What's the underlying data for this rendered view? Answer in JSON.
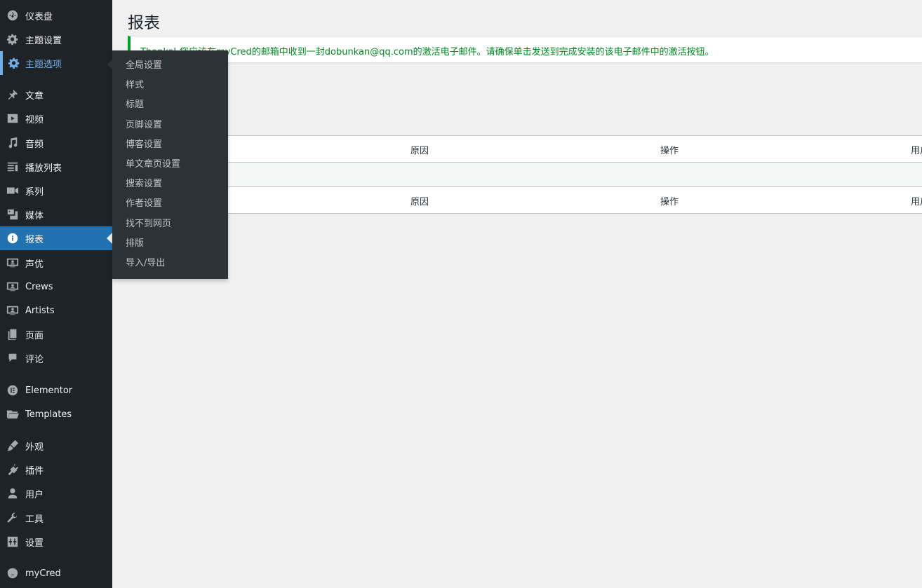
{
  "sidebar": {
    "items": [
      {
        "label": "仪表盘",
        "icon": "dashboard-icon"
      },
      {
        "label": "主题设置",
        "icon": "gear-icon"
      },
      {
        "label": "主题选项",
        "icon": "gear-icon"
      },
      {
        "label": "文章",
        "icon": "pin-icon"
      },
      {
        "label": "视频",
        "icon": "video-icon"
      },
      {
        "label": "音频",
        "icon": "music-icon"
      },
      {
        "label": "播放列表",
        "icon": "playlist-icon"
      },
      {
        "label": "系列",
        "icon": "camera-icon"
      },
      {
        "label": "媒体",
        "icon": "media-icon"
      },
      {
        "label": "报表",
        "icon": "info-icon"
      },
      {
        "label": "声优",
        "icon": "person-display-icon"
      },
      {
        "label": "Crews",
        "icon": "person-display-icon"
      },
      {
        "label": "Artists",
        "icon": "person-display-icon"
      },
      {
        "label": "页面",
        "icon": "page-icon"
      },
      {
        "label": "评论",
        "icon": "comment-icon"
      },
      {
        "label": "Elementor",
        "icon": "elementor-icon"
      },
      {
        "label": "Templates",
        "icon": "folder-icon"
      },
      {
        "label": "外观",
        "icon": "brush-icon"
      },
      {
        "label": "插件",
        "icon": "plugin-icon"
      },
      {
        "label": "用户",
        "icon": "user-icon"
      },
      {
        "label": "工具",
        "icon": "wrench-icon"
      },
      {
        "label": "设置",
        "icon": "settings-sliders-icon"
      },
      {
        "label": "myCred",
        "icon": "mycred-icon"
      }
    ]
  },
  "flyout": {
    "items": [
      "全局设置",
      "样式",
      "标题",
      "页脚设置",
      "博客设置",
      "单文章页设置",
      "搜索设置",
      "作者设置",
      "找不到网页",
      "排版",
      "导入/导出"
    ]
  },
  "page": {
    "title": "报表",
    "notice": "Thanks! 您应该在myCred的邮箱中收到一封dobunkan@qq.com的激活电子邮件。请确保单击发送到完成安装的该电子邮件中的激活按钮。"
  },
  "table": {
    "columns": [
      "原因",
      "操作",
      "用户"
    ]
  },
  "colors": {
    "sidebar_bg": "#1d2327",
    "current_bg": "#2271b1",
    "hover_text": "#72aee6",
    "notice_border": "#00a32a"
  }
}
